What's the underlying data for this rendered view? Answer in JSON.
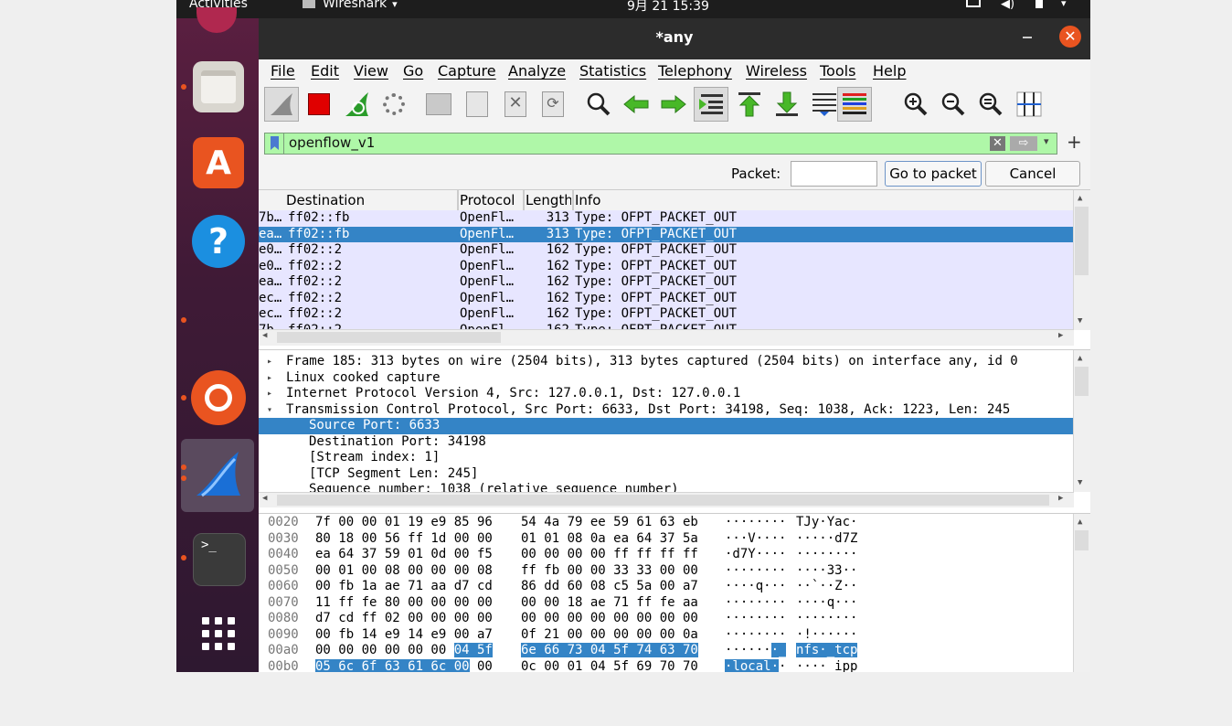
{
  "system_bar": {
    "activities": "Activities",
    "app_name": "Wireshark",
    "clock": "9月 21  15:39"
  },
  "window": {
    "title": "*any"
  },
  "menu": [
    "File",
    "Edit",
    "View",
    "Go",
    "Capture",
    "Analyze",
    "Statistics",
    "Telephony",
    "Wireless",
    "Tools",
    "Help"
  ],
  "filter": {
    "value": "openflow_v1"
  },
  "goto": {
    "label": "Packet:",
    "value": "",
    "go_button": "Go to packet",
    "cancel_button": "Cancel"
  },
  "packet_list": {
    "columns": [
      "Destination",
      "Protocol",
      "Length",
      "Info"
    ],
    "rows": [
      {
        "src": "7b…",
        "dst": "ff02::fb",
        "proto": "OpenFl…",
        "len": "313",
        "info": "Type: OFPT_PACKET_OUT"
      },
      {
        "src": "ea…",
        "dst": "ff02::fb",
        "proto": "OpenFl…",
        "len": "313",
        "info": "Type: OFPT_PACKET_OUT",
        "selected": true
      },
      {
        "src": "e0…",
        "dst": "ff02::2",
        "proto": "OpenFl…",
        "len": "162",
        "info": "Type: OFPT_PACKET_OUT"
      },
      {
        "src": "e0…",
        "dst": "ff02::2",
        "proto": "OpenFl…",
        "len": "162",
        "info": "Type: OFPT_PACKET_OUT"
      },
      {
        "src": "ea…",
        "dst": "ff02::2",
        "proto": "OpenFl…",
        "len": "162",
        "info": "Type: OFPT_PACKET_OUT"
      },
      {
        "src": "ec…",
        "dst": "ff02::2",
        "proto": "OpenFl…",
        "len": "162",
        "info": "Type: OFPT_PACKET_OUT"
      },
      {
        "src": "ec…",
        "dst": "ff02::2",
        "proto": "OpenFl…",
        "len": "162",
        "info": "Type: OFPT_PACKET_OUT"
      },
      {
        "src": "7b…",
        "dst": "ff02::2",
        "proto": "OpenFl…",
        "len": "162",
        "info": "Type: OFPT_PACKET_OUT"
      }
    ]
  },
  "details": [
    {
      "text": "Frame 185: 313 bytes on wire (2504 bits), 313 bytes captured (2504 bits) on interface any, id 0",
      "indent": 0,
      "expander": "collapsed"
    },
    {
      "text": "Linux cooked capture",
      "indent": 0,
      "expander": "collapsed"
    },
    {
      "text": "Internet Protocol Version 4, Src: 127.0.0.1, Dst: 127.0.0.1",
      "indent": 0,
      "expander": "collapsed"
    },
    {
      "text": "Transmission Control Protocol, Src Port: 6633, Dst Port: 34198, Seq: 1038, Ack: 1223, Len: 245",
      "indent": 0,
      "expander": "expanded"
    },
    {
      "text": "Source Port: 6633",
      "indent": 1,
      "selected": true
    },
    {
      "text": "Destination Port: 34198",
      "indent": 1
    },
    {
      "text": "[Stream index: 1]",
      "indent": 1
    },
    {
      "text": "[TCP Segment Len: 245]",
      "indent": 1
    },
    {
      "text": "Sequence number: 1038    (relative sequence number)",
      "indent": 1
    }
  ],
  "hex": [
    {
      "off": "0020",
      "h1": "7f 00 00 01 19 e9 85 96",
      "h2": "54 4a 79 ee 59 61 63 eb",
      "a1": "········",
      "a2": "TJy·Yac·"
    },
    {
      "off": "0030",
      "h1": "80 18 00 56 ff 1d 00 00",
      "h2": "01 01 08 0a ea 64 37 5a",
      "a1": "···V····",
      "a2": "·····d7Z"
    },
    {
      "off": "0040",
      "h1": "ea 64 37 59 01 0d 00 f5",
      "h2": "00 00 00 00 ff ff ff ff",
      "a1": "·d7Y····",
      "a2": "········"
    },
    {
      "off": "0050",
      "h1": "00 01 00 08 00 00 00 08",
      "h2": "ff fb 00 00 33 33 00 00",
      "a1": "········",
      "a2": "····33··"
    },
    {
      "off": "0060",
      "h1": "00 fb 1a ae 71 aa d7 cd",
      "h2": "86 dd 60 08 c5 5a 00 a7",
      "a1": "····q···",
      "a2": "··`··Z··"
    },
    {
      "off": "0070",
      "h1": "11 ff fe 80 00 00 00 00",
      "h2": "00 00 18 ae 71 ff fe aa",
      "a1": "········",
      "a2": "····q···"
    },
    {
      "off": "0080",
      "h1": "d7 cd ff 02 00 00 00 00",
      "h2": "00 00 00 00 00 00 00 00",
      "a1": "········",
      "a2": "········"
    },
    {
      "off": "0090",
      "h1": "00 fb 14 e9 14 e9 00 a7",
      "h2": "0f 21 00 00 00 00 00 0a",
      "a1": "········",
      "a2": "·!······"
    },
    {
      "off": "00a0",
      "h1": "00 00 00 00 00 00",
      "h1b": "04 5f",
      "h2": "6e 66 73 04 5f 74 63 70",
      "a1": "······",
      "a1b": "·_",
      "a2": "nfs·_tcp",
      "hl": "tail"
    },
    {
      "off": "00b0",
      "h1": "05 6c 6f 63 61 6c 00",
      "h1b": "00",
      "h2": "0c 00 01 04 5f 69 70 70",
      "a1": "·local·",
      "a1b": "·",
      "a2": "····_ipp",
      "hl": "head"
    }
  ],
  "colors": {
    "filter_bg": "#aff7a8",
    "selected_row": "#3484c6",
    "openflow_row": "#e7e6ff",
    "ubuntu_orange": "#e95420",
    "close_button": "#e95420"
  },
  "icons": {
    "dock": [
      "files-icon",
      "app-store-icon",
      "help-icon",
      "ubuntu-software-icon",
      "wireshark-icon",
      "terminal-icon",
      "show-apps-icon"
    ]
  }
}
